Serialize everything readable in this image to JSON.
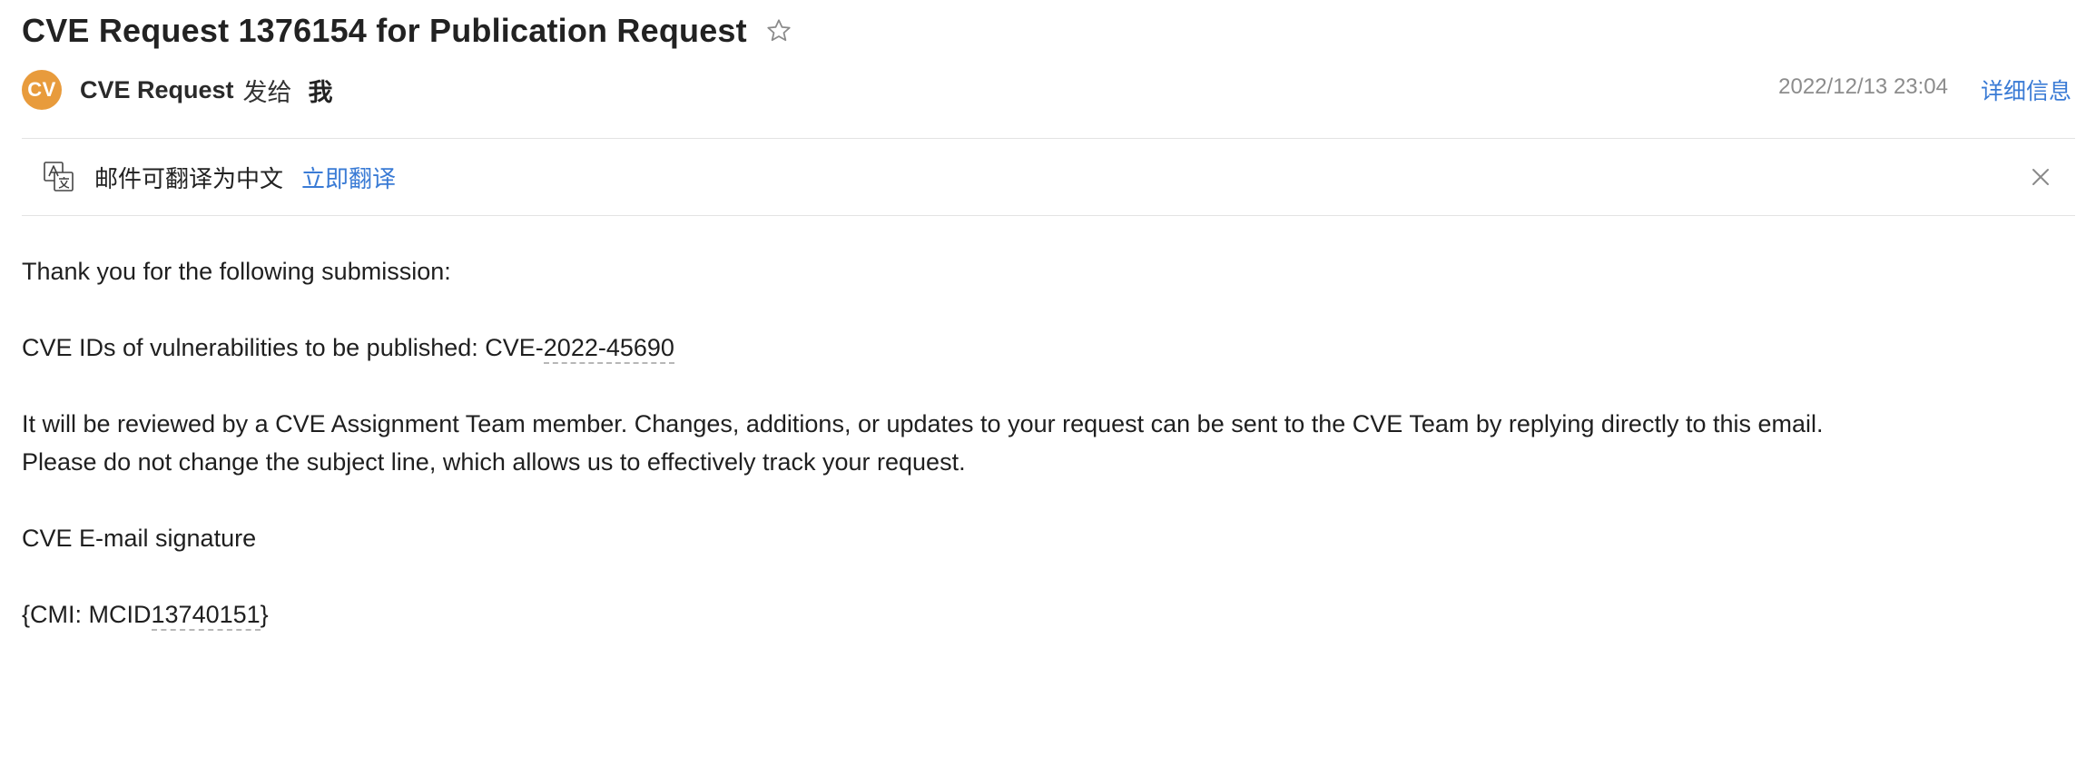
{
  "email": {
    "subject": "CVE Request 1376154 for Publication Request",
    "sender": {
      "avatar_initials": "CV",
      "avatar_color": "#E89B3C",
      "name": "CVE Request",
      "sent_to_label": "发给",
      "recipient": "我"
    },
    "date": "2022/12/13 23:04",
    "details_label": "详细信息"
  },
  "translate_bar": {
    "message": "邮件可翻译为中文",
    "action_label": "立即翻译"
  },
  "body": {
    "line1": "Thank you for the following submission:",
    "line2_prefix": "CVE IDs of vulnerabilities to be published: CVE-",
    "line2_highlight": "2022-45690",
    "line3": "It will be reviewed by a CVE Assignment Team member. Changes, additions, or updates to your request can be sent to the CVE Team by replying directly to this email.",
    "line4": "Please do not change the subject line, which allows us to effectively track your request.",
    "signature": "CVE E-mail signature",
    "cmi_prefix": "{CMI: MCID",
    "cmi_highlight": "13740151",
    "cmi_suffix": "}"
  },
  "icons": {
    "star": "star-outline-icon",
    "translate": "translate-icon",
    "close": "close-icon"
  },
  "colors": {
    "link": "#3A7BD5",
    "date": "#8C8C8C"
  }
}
